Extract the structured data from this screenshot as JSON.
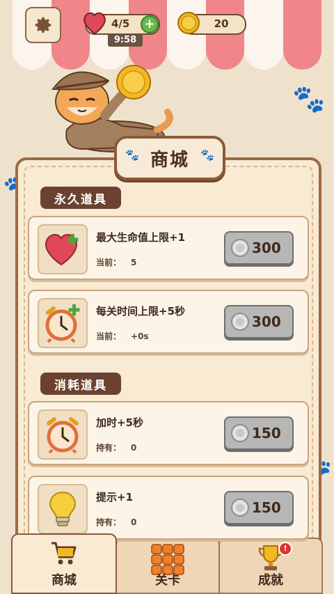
{
  "header": {
    "lives": "4/5",
    "timer": "9:58",
    "coins": "20"
  },
  "title": "商城",
  "sections": [
    {
      "label": "永久道具"
    },
    {
      "label": "消耗道具"
    }
  ],
  "items": [
    {
      "name": "最大生命值上限+1",
      "sub_label": "当前：",
      "sub_value": "5",
      "price": "300",
      "icon": "heart-plus-icon"
    },
    {
      "name": "每关时间上限+5秒",
      "sub_label": "当前：",
      "sub_value": "+0s",
      "price": "300",
      "icon": "alarm-clock-plus-icon"
    },
    {
      "name": "加时+5秒",
      "sub_label": "持有：",
      "sub_value": "0",
      "price": "150",
      "icon": "alarm-clock-icon"
    },
    {
      "name": "提示+1",
      "sub_label": "持有：",
      "sub_value": "0",
      "price": "150",
      "icon": "lightbulb-icon"
    }
  ],
  "nav": {
    "tabs": [
      {
        "label": "商城",
        "icon": "shopping-cart-icon",
        "active": true
      },
      {
        "label": "关卡",
        "icon": "level-grid-icon",
        "active": false
      },
      {
        "label": "成就",
        "icon": "trophy-icon",
        "active": false,
        "badge": "!"
      }
    ]
  },
  "colors": {
    "accent_brown": "#6b4230",
    "awning_red": "#f0868a",
    "coin_gold": "#f3b720",
    "heart_red": "#e0485a"
  }
}
